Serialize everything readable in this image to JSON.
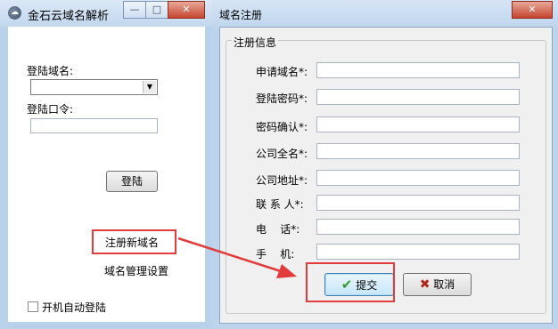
{
  "login_window": {
    "title": "金石云域名解析",
    "window_buttons": {
      "minimize": "—",
      "maximize": "□",
      "close": "✕"
    },
    "domain_label": "登陆域名:",
    "domain_value": "",
    "password_label": "登陆口令:",
    "password_value": "",
    "login_button": "登陆",
    "register_link": "注册新域名",
    "manage_link": "域名管理设置",
    "autostart_label": "开机自动登陆",
    "autostart_checked": false
  },
  "register_window": {
    "title": "域名注册",
    "close_button": "✕",
    "group_title": "注册信息",
    "fields": [
      {
        "label": "申请域名*:",
        "value": ""
      },
      {
        "label": "登陆密码*:",
        "value": ""
      },
      {
        "label": "密码确认*:",
        "value": ""
      },
      {
        "label": "公司全名*:",
        "value": ""
      },
      {
        "label": "公司地址*:",
        "value": ""
      },
      {
        "label": "联 系 人*:",
        "value": ""
      },
      {
        "label": "电    话*:",
        "value": ""
      },
      {
        "label": "手    机:",
        "value": ""
      }
    ],
    "submit_button": "提交",
    "cancel_button": "取消"
  },
  "annotation_colors": {
    "highlight": "#e23b3b"
  },
  "icons": {
    "app": "cloud-app-icon",
    "submit": "checkmark-icon",
    "cancel": "x-icon"
  }
}
